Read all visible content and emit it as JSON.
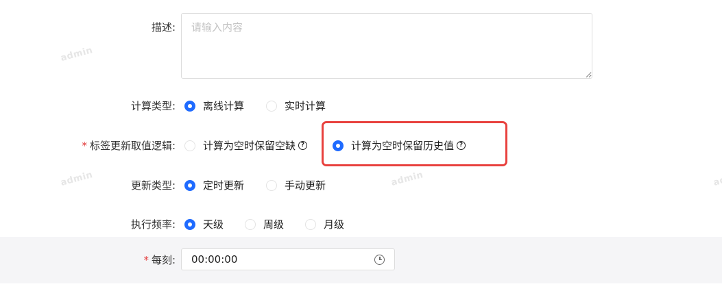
{
  "watermark": "admin",
  "form": {
    "description": {
      "label": "描述:",
      "placeholder": "请输入内容"
    },
    "calc_type": {
      "label": "计算类型:",
      "options": [
        "离线计算",
        "实时计算"
      ],
      "selected": 0
    },
    "tag_logic": {
      "required_mark": "*",
      "label": "标签更新取值逻辑:",
      "options": [
        "计算为空时保留空缺",
        "计算为空时保留历史值"
      ],
      "selected": 1,
      "help_icon": "question-circle-icon"
    },
    "update_type": {
      "label": "更新类型:",
      "options": [
        "定时更新",
        "手动更新"
      ],
      "selected": 0
    },
    "frequency": {
      "label": "执行频率:",
      "options": [
        "天级",
        "周级",
        "月级"
      ],
      "selected": 0
    },
    "every_time": {
      "required_mark": "*",
      "label": "每刻:",
      "value": "00:00:00",
      "icon": "clock-icon"
    }
  },
  "colors": {
    "accent": "#1f6bff",
    "highlight": "#e8413e",
    "required": "#e23b3b"
  }
}
